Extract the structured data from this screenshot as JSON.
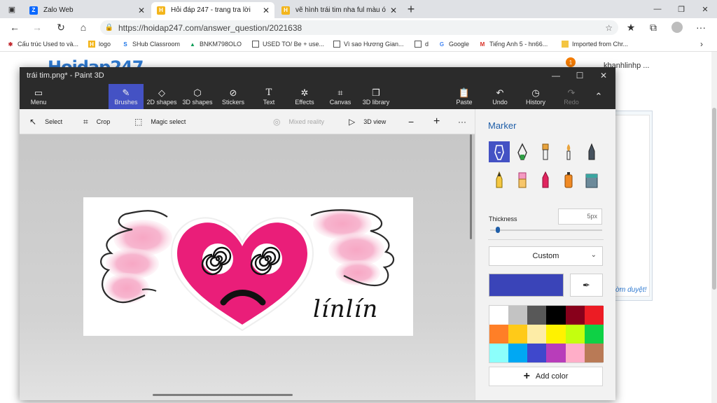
{
  "browser": {
    "tabs": [
      {
        "title": "Zalo Web",
        "favicon": "zalo-icon"
      },
      {
        "title": "Hỏi đáp 247 - trang tra lời",
        "favicon": "hoidap-icon"
      },
      {
        "title": "vẽ hình trái tim nha ful màu ó kè",
        "favicon": "hoidap-icon"
      }
    ],
    "new_tab": "+",
    "url": "https://hoidap247.com/answer_question/2021638",
    "bookmarks": [
      {
        "label": "Cấu trúc Used to và...",
        "icon": "star-icon"
      },
      {
        "label": "logo",
        "icon": "hoidap-icon"
      },
      {
        "label": "SHub Classroom",
        "icon": "shub-icon"
      },
      {
        "label": "BNKM798OLO",
        "icon": "drive-icon"
      },
      {
        "label": "USED TO/ Be + use...",
        "icon": "doc-icon"
      },
      {
        "label": "Vì sao Hương Gian...",
        "icon": "doc-icon"
      },
      {
        "label": "d",
        "icon": "doc-icon"
      },
      {
        "label": "Google",
        "icon": "google-icon"
      },
      {
        "label": "Tiếng Anh 5 - hn66...",
        "icon": "gmail-icon"
      },
      {
        "label": "Imported from Chr...",
        "icon": "folder-icon"
      }
    ]
  },
  "site": {
    "logo": "Hoidap247",
    "username": "khanhlinhp ...",
    "notification_count": "1",
    "pending_text": "ờm duyệt!"
  },
  "paint": {
    "title": "trái tim.png* - Paint 3D",
    "tools": [
      {
        "label": "Menu",
        "icon": "folder-icon"
      },
      {
        "label": "Brushes",
        "icon": "brush-icon"
      },
      {
        "label": "2D shapes",
        "icon": "shapes-2d-icon"
      },
      {
        "label": "3D shapes",
        "icon": "cube-icon"
      },
      {
        "label": "Stickers",
        "icon": "sticker-icon"
      },
      {
        "label": "Text",
        "icon": "text-icon"
      },
      {
        "label": "Effects",
        "icon": "effects-icon"
      },
      {
        "label": "Canvas",
        "icon": "canvas-icon"
      },
      {
        "label": "3D library",
        "icon": "library-icon"
      },
      {
        "label": "Paste",
        "icon": "paste-icon"
      },
      {
        "label": "Undo",
        "icon": "undo-icon"
      },
      {
        "label": "History",
        "icon": "history-icon"
      },
      {
        "label": "Redo",
        "icon": "redo-icon"
      }
    ],
    "subtools": [
      {
        "label": "Select",
        "icon": "cursor-icon"
      },
      {
        "label": "Crop",
        "icon": "crop-icon"
      },
      {
        "label": "Magic select",
        "icon": "magic-select-icon"
      },
      {
        "label": "Mixed reality",
        "icon": "mixed-reality-icon"
      },
      {
        "label": "3D view",
        "icon": "3d-view-icon"
      },
      {
        "label": "−",
        "icon": "zoom-out-icon"
      },
      {
        "label": "+",
        "icon": "zoom-in-icon"
      },
      {
        "label": "···",
        "icon": "more-icon"
      }
    ],
    "signature": "línlín",
    "panel": {
      "title": "Marker",
      "thickness_label": "Thickness",
      "thickness_value": "5px",
      "thickness_level": 0.05,
      "color_mode": "Custom",
      "current_color": "#3a44b8",
      "add_color": "Add color",
      "brushes": [
        "marker-icon",
        "calligraphy-pen-icon",
        "oil-brush-icon",
        "watercolor-icon",
        "pixel-pen-icon",
        "pencil-icon",
        "eraser-icon",
        "crayon-icon",
        "spray-can-icon",
        "fill-icon"
      ],
      "palette": [
        "#ffffff",
        "#c3c3c3",
        "#585858",
        "#000000",
        "#88001b",
        "#ec1c24",
        "#ff7f27",
        "#ffca18",
        "#fdeca6",
        "#fff200",
        "#c4ff0e",
        "#0ed145",
        "#8cfffb",
        "#00a8f3",
        "#3f48cc",
        "#b83dba",
        "#ffaec8",
        "#b97a56"
      ]
    }
  }
}
